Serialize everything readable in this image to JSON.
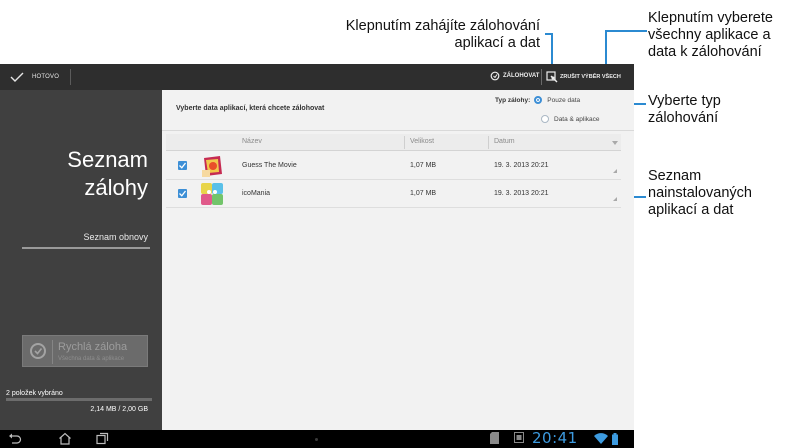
{
  "callouts": {
    "start_backup": "Klepnutím zahájíte zálohování aplikací a dat",
    "select_all": "Klepnutím vyberete všechny aplikace a data k zálohování",
    "select_type": "Vyberte typ zálohování",
    "list": "Seznam nainstalovaných aplikací a dat"
  },
  "action_bar": {
    "done_label": "HOTOVO",
    "backup_label": "ZÁLOHOVAT",
    "deselect_all_label": "ZRUŠIT VÝBĚR VŠECH"
  },
  "left_panel": {
    "title_line1": "Seznam",
    "title_line2": "zálohy",
    "restore_list": "Seznam obnovy",
    "quick_backup_title": "Rychlá záloha",
    "quick_backup_sub": "Všechna data & aplikace",
    "selected_count": "2 položek vybráno",
    "selected_size": "2,14 MB / 2,00 GB"
  },
  "main": {
    "header": "Vyberte data aplikací, která chcete zálohovat",
    "backup_type_label": "Typ zálohy:",
    "backup_type_options": [
      "Pouze data",
      "Data & aplikace"
    ],
    "columns": [
      "Název",
      "Velikost",
      "Datum"
    ],
    "rows": [
      {
        "name": "Guess The Movie",
        "size": "1,07 MB",
        "date": "19. 3. 2013 20:21",
        "checked": true
      },
      {
        "name": "icoMania",
        "size": "1,07 MB",
        "date": "19. 3. 2013 20:21",
        "checked": true
      }
    ]
  },
  "status_bar": {
    "clock": "20:41"
  },
  "colors": {
    "accent": "#3d8fd6",
    "callout_line": "#2b8ad1",
    "action_bar": "#2e2e2e",
    "left_panel": "#404040"
  },
  "icons": [
    "check-icon",
    "backup-icon",
    "deselect-icon",
    "back-icon",
    "home-icon",
    "recent-apps-icon",
    "wifi-icon",
    "battery-icon"
  ]
}
